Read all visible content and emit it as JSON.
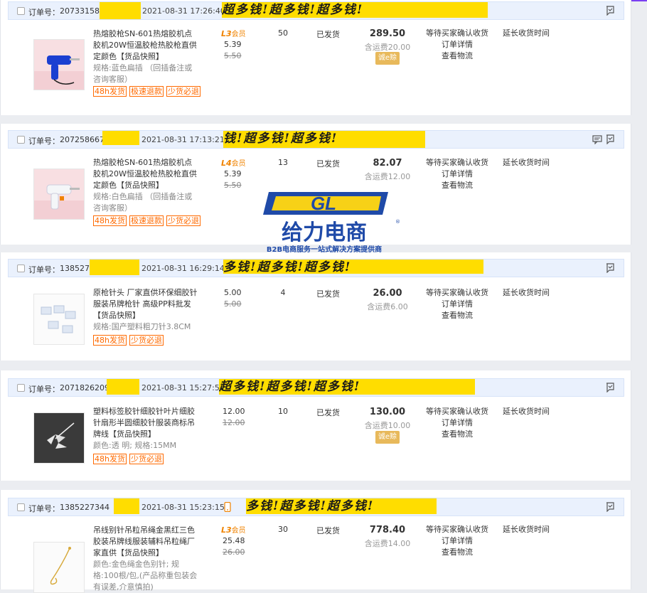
{
  "orders": [
    {
      "label": "订单号：",
      "num": "2073315819",
      "time": "2021-08-31 17:26:40",
      "mask_text": "超多钱!超多钱!超多钱!",
      "title": "热熔胶枪SN-601热熔胶机点胶机20W恒温胶枪热胶枪直供定颜色",
      "snapshot": "【货品快照】",
      "spec": "规格:蓝色扁插 （回插备注或咨询客服）",
      "tags": [
        "48h发货",
        "极速退款",
        "少货必退"
      ],
      "tier": "L3",
      "tier_sub": "会员",
      "price": "5.39",
      "orig": "5.50",
      "qty": "50",
      "status": "已发货",
      "total": "289.50",
      "ship": "含运费20.00",
      "honesty": "诚e赊",
      "actions": [
        "等待买家确认收货",
        "订单详情",
        "查看物流"
      ],
      "extend": "延长收货时间"
    },
    {
      "label": "订单号：",
      "num": "2072586674",
      "time": "2021-08-31 17:13:21",
      "mask_text": "钱!超多钱!超多钱!",
      "title": "热熔胶枪SN-601热熔胶机点胶机20W恒温胶枪热胶枪直供定颜色",
      "snapshot": "【货品快照】",
      "spec": "规格:白色扁插 （回插备注或咨询客服）",
      "tags": [
        "48h发货",
        "极速退款",
        "少货必退"
      ],
      "tier": "L4",
      "tier_sub": "会员",
      "price": "5.39",
      "orig": "5.50",
      "qty": "13",
      "status": "已发货",
      "total": "82.07",
      "ship": "含运费12.00",
      "honesty": "",
      "actions": [
        "等待买家确认收货",
        "订单详情",
        "查看物流"
      ],
      "extend": "延长收货时间"
    },
    {
      "label": "订单号：",
      "num": "1385274",
      "time": "2021-08-31 16:29:14",
      "mask_text": "多钱!超多钱!超多钱!",
      "title": "原枪针头 厂家直供环保细胶针服装吊牌枪针 高级PP料批发",
      "snapshot": "【货品快照】",
      "spec": "规格:国产塑料粗刀针3.8CM",
      "tags": [
        "48h发货",
        "少货必退"
      ],
      "tier": "",
      "tier_sub": "",
      "price": "5.00",
      "orig": "5.00",
      "qty": "4",
      "status": "已发货",
      "total": "26.00",
      "ship": "含运费6.00",
      "honesty": "",
      "actions": [
        "等待买家确认收货",
        "订单详情",
        "查看物流"
      ],
      "extend": "延长收货时间"
    },
    {
      "label": "订单号：",
      "num": "2071826209",
      "time": "2021-08-31 15:27:56",
      "mask_text": "超多钱!超多钱!超多钱!",
      "title": "塑料标签胶针细胶针叶片细胶针扇形半圆细胶针服装商标吊牌线",
      "snapshot": "【货品快照】",
      "spec": "颜色:透 明; 规格:15MM",
      "tags": [
        "48h发货",
        "少货必退"
      ],
      "tier": "",
      "tier_sub": "",
      "price": "12.00",
      "orig": "12.00",
      "qty": "10",
      "status": "已发货",
      "total": "130.00",
      "ship": "含运费10.00",
      "honesty": "诚e赊",
      "actions": [
        "等待买家确认收货",
        "订单详情",
        "查看物流"
      ],
      "extend": "延长收货时间"
    },
    {
      "label": "订单号：",
      "num": "1385227344",
      "time": "2021-08-31 15:23:15",
      "mask_text": "多钱!超多钱!超多钱!",
      "title": "吊线别针吊粒吊绳金黑红三色胶装吊牌线服装辅料吊粒绳厂家直供",
      "snapshot": "【货品快照】",
      "spec": "颜色:金色绳金色别针; 规格:100根/包,(产品称重包装会有误差,介意慎拍)",
      "tags": [],
      "tier": "L3",
      "tier_sub": "会员",
      "price": "25.48",
      "orig": "26.00",
      "qty": "30",
      "status": "已发货",
      "total": "778.40",
      "ship": "含运费14.00",
      "honesty": "",
      "actions": [
        "等待买家确认收货",
        "订单详情",
        "查看物流"
      ],
      "extend": "延长收货时间"
    }
  ],
  "watermark": {
    "brand": "给力电商",
    "tagline": "B2B电商服务一站式解决方案提供商",
    "logo_letters": "GL",
    "color": "#1f4aa8",
    "accent": "#f7d117"
  }
}
